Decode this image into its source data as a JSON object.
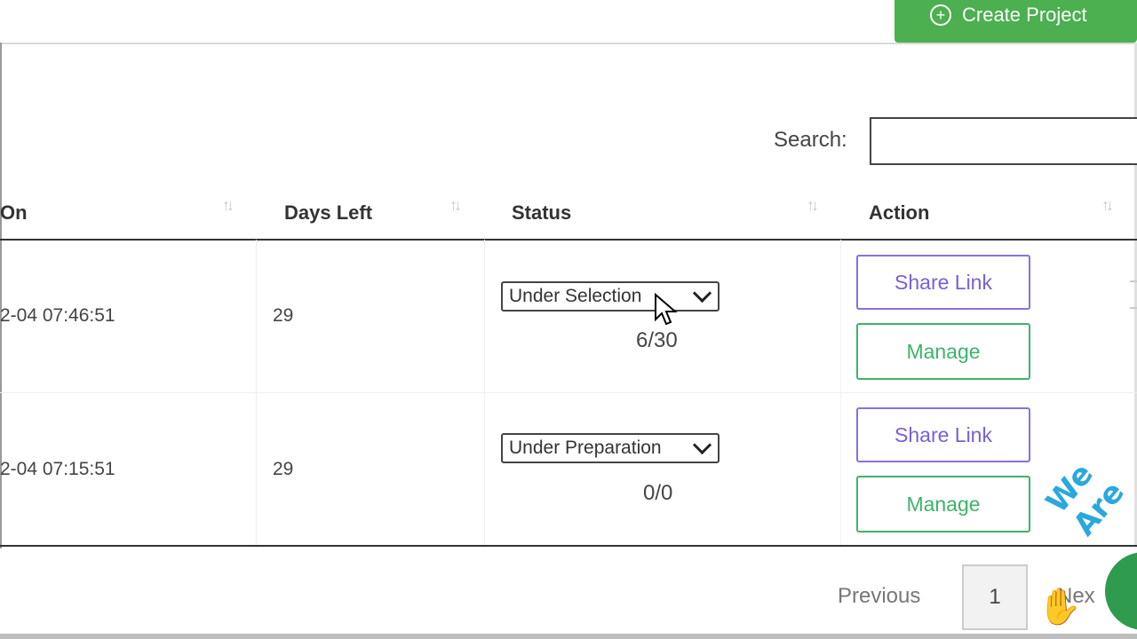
{
  "header": {
    "create_label": "Create Project"
  },
  "search": {
    "label": "Search:",
    "value": ""
  },
  "table": {
    "columns": [
      "On",
      "Days Left",
      "Status",
      "Action"
    ],
    "rows": [
      {
        "date": "2-04 07:46:51",
        "days_left": "29",
        "status": "Under Selection",
        "count": "6/30",
        "share": "Share Link",
        "manage": "Manage"
      },
      {
        "date": "2-04 07:15:51",
        "days_left": "29",
        "status": "Under Preparation",
        "count": "0/0",
        "share": "Share Link",
        "manage": "Manage"
      }
    ]
  },
  "pagination": {
    "previous": "Previous",
    "page": "1",
    "next": "Nex"
  },
  "overlay": {
    "watermark": "We Are"
  },
  "colors": {
    "create_button": "#4caf50",
    "share_border": "#8a6fe0",
    "manage_border": "#3db36a"
  }
}
